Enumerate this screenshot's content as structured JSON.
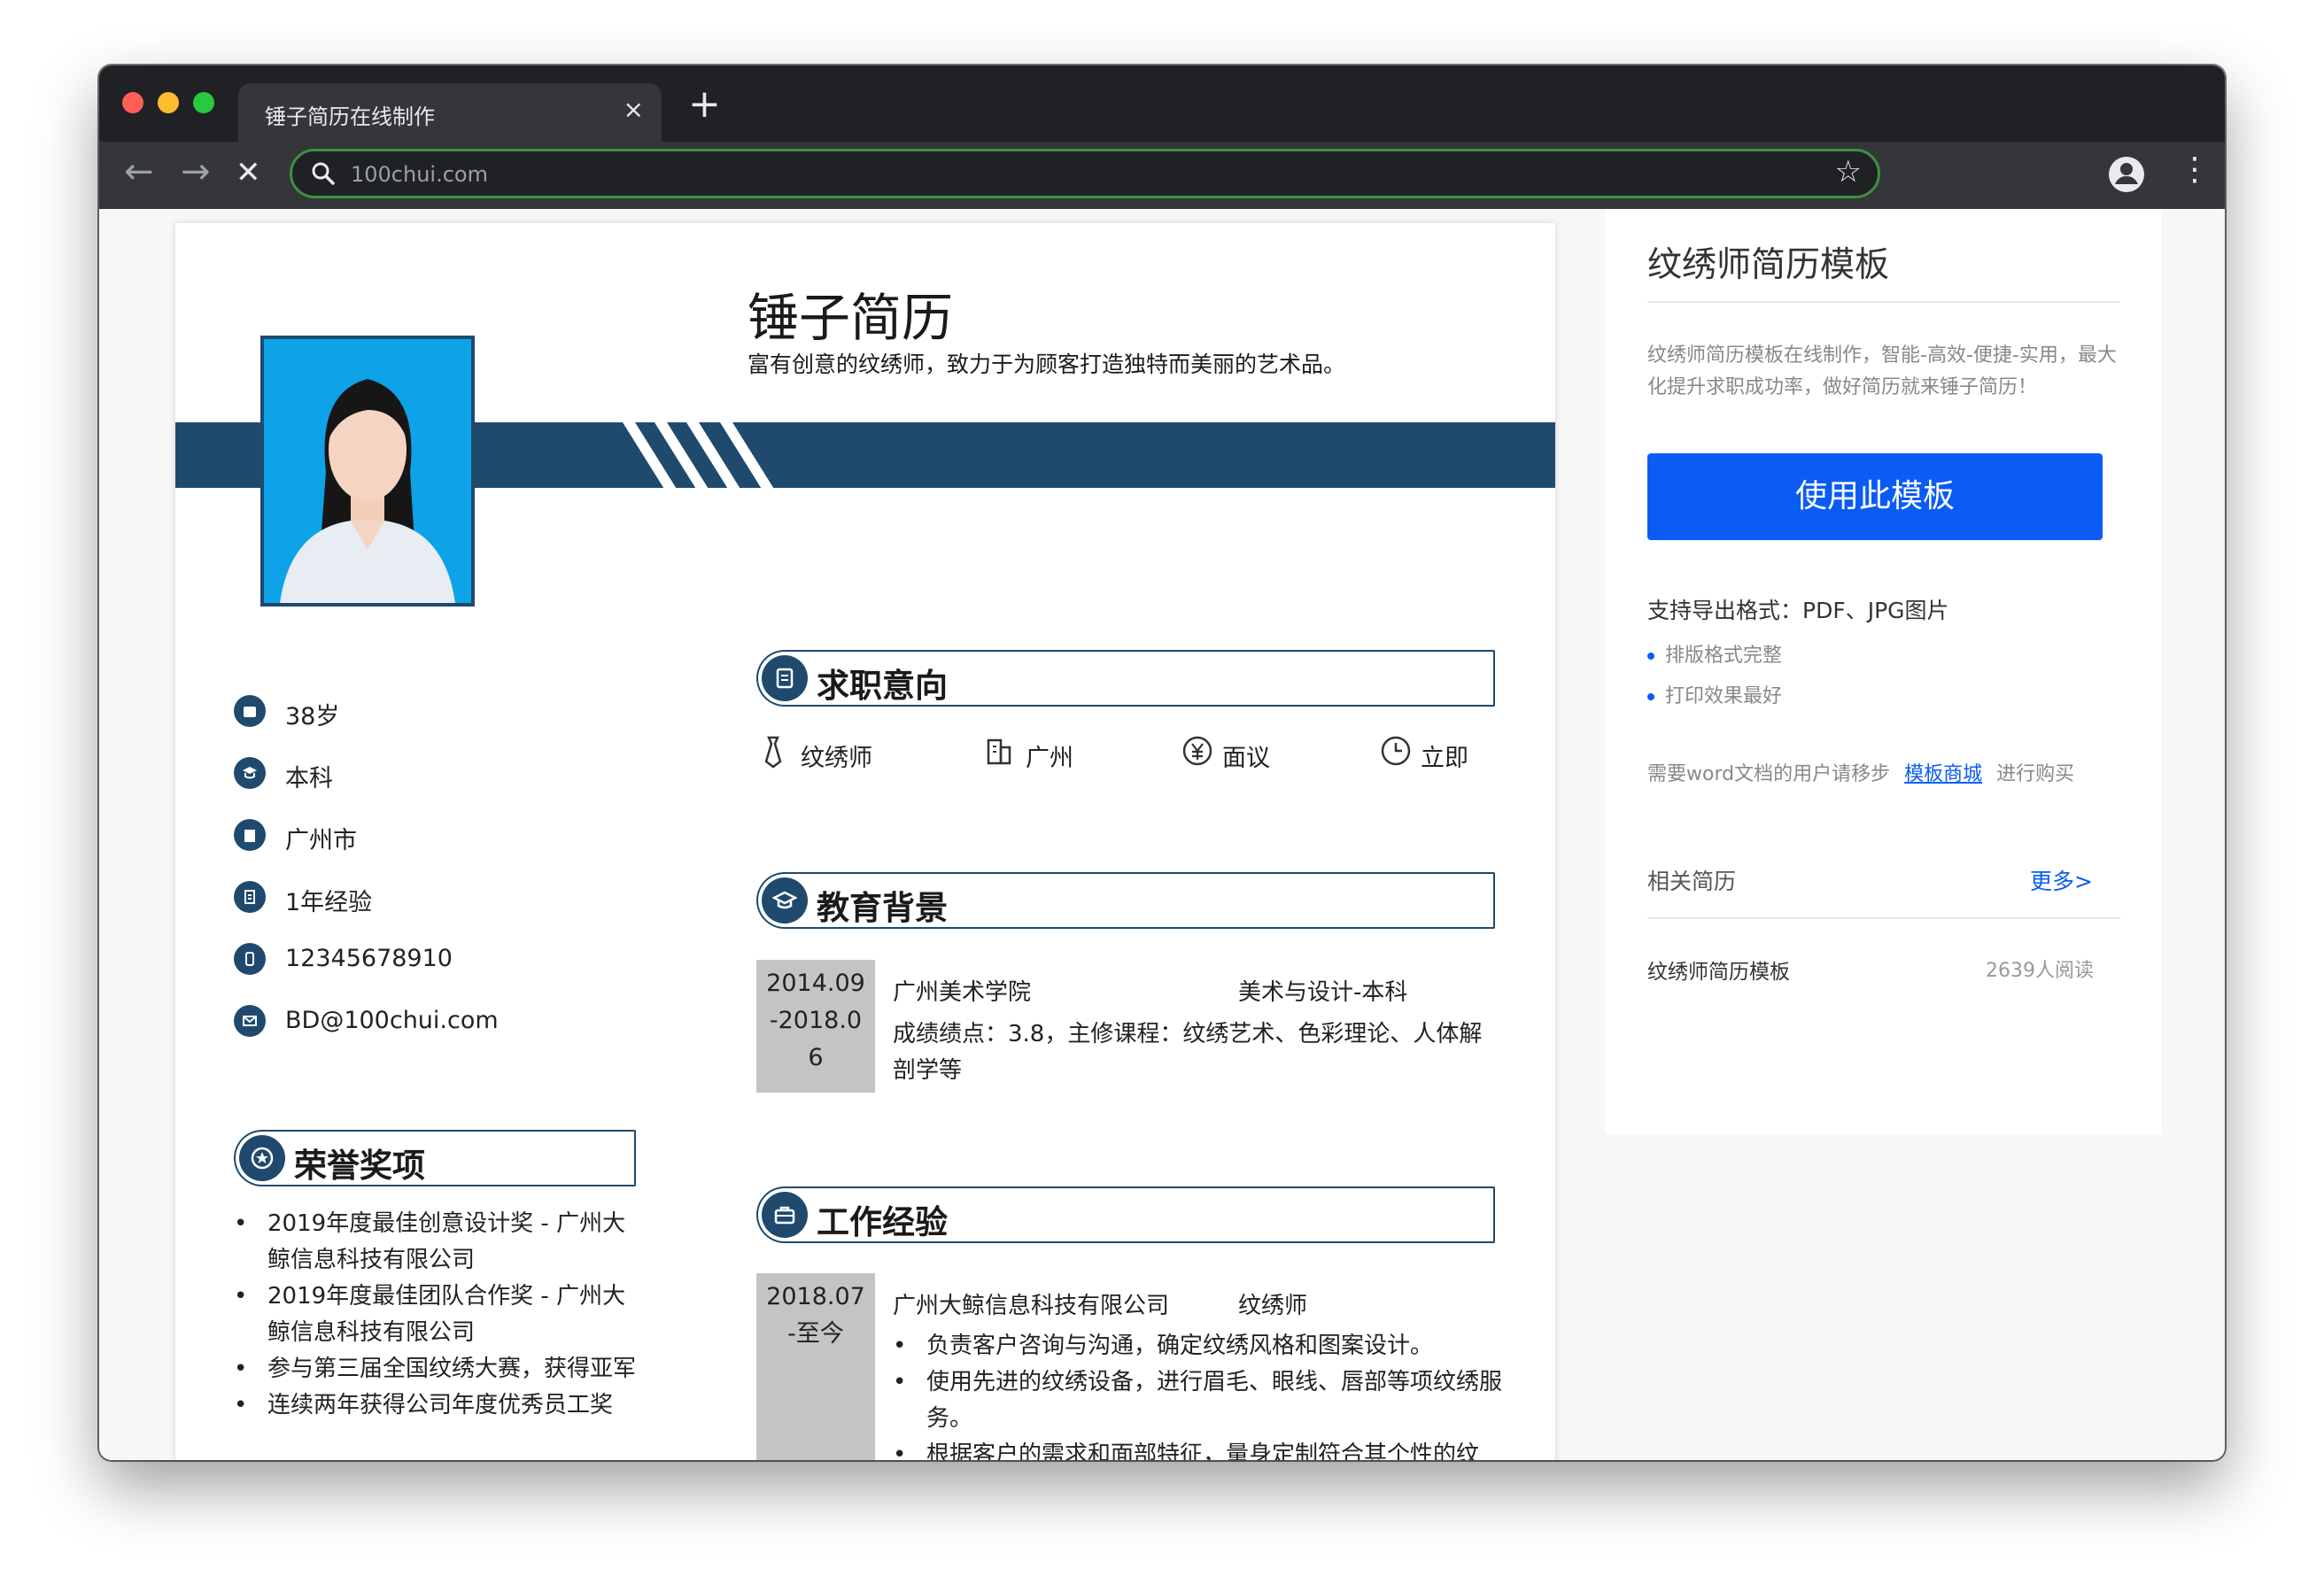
{
  "browser": {
    "tab_title": "锤子简历在线制作",
    "tab_close": "×",
    "new_tab": "+",
    "url": "100chui.com",
    "back": "←",
    "forward": "→",
    "stop": "✕",
    "star": "☆",
    "menu": "⋮",
    "icons": [
      "search-icon",
      "bookmark-star-icon",
      "profile-icon",
      "more-menu-icon"
    ]
  },
  "resume": {
    "name": "锤子简历",
    "tagline": "富有创意的纹绣师，致力于为顾客打造独特而美丽的艺术品。",
    "info": [
      {
        "text": "38岁",
        "icon": "age-icon"
      },
      {
        "text": "本科",
        "icon": "education-icon"
      },
      {
        "text": "广州市",
        "icon": "city-icon"
      },
      {
        "text": "1年经验",
        "icon": "experience-icon"
      },
      {
        "text": "12345678910",
        "icon": "phone-icon"
      },
      {
        "text": "BD@100chui.com",
        "icon": "email-icon"
      }
    ],
    "intent": {
      "title": "求职意向",
      "position": "纹绣师",
      "city": "广州",
      "salary": "面议",
      "start": "立即"
    },
    "education": {
      "title": "教育背景",
      "date": [
        "2014.09",
        "-2018.0",
        "6"
      ],
      "school": "广州美术学院",
      "major": "美术与设计-本科",
      "details": "成绩绩点：3.8，主修课程：纹绣艺术、色彩理论、人体解剖学等"
    },
    "work": {
      "title": "工作经验",
      "date": [
        "2018.07",
        "-至今"
      ],
      "company": "广州大鲸信息科技有限公司",
      "role": "纹绣师",
      "bullets": [
        "负责客户咨询与沟通，确定纹绣风格和图案设计。",
        "使用先进的纹绣设备，进行眉毛、眼线、唇部等项纹绣服务。",
        "根据客户的需求和面部特征，量身定制符合其个性的纹"
      ]
    },
    "honors": {
      "title": "荣誉奖项",
      "items": [
        "2019年度最佳创意设计奖 - 广州大鲸信息科技有限公司",
        "2019年度最佳团队合作奖 - 广州大鲸信息科技有限公司",
        "参与第三届全国纹绣大赛，获得亚军",
        "连续两年获得公司年度优秀员工奖"
      ]
    }
  },
  "sidebar": {
    "title": "纹绣师简历模板",
    "description": "纹绣师简历模板在线制作，智能-高效-便捷-实用，最大化提升求职成功率，做好简历就来锤子简历！",
    "use_button": "使用此模板",
    "formats": "支持导出格式：PDF、JPG图片",
    "features": [
      "排版格式完整",
      "打印效果最好"
    ],
    "note_before": "需要word文档的用户请移步",
    "note_link": "模板商城",
    "note_after": "进行购买",
    "related_title": "相关简历",
    "more": "更多>",
    "related_item": "纹绣师简历模板",
    "related_reads": "2639人阅读"
  },
  "colors": {
    "chrome_dark": "#202124",
    "chrome_toolbar": "#35363a",
    "resume_navy": "#1f4a6e",
    "accent_blue": "#0a5cf5",
    "date_gray": "#c4c4c4"
  }
}
